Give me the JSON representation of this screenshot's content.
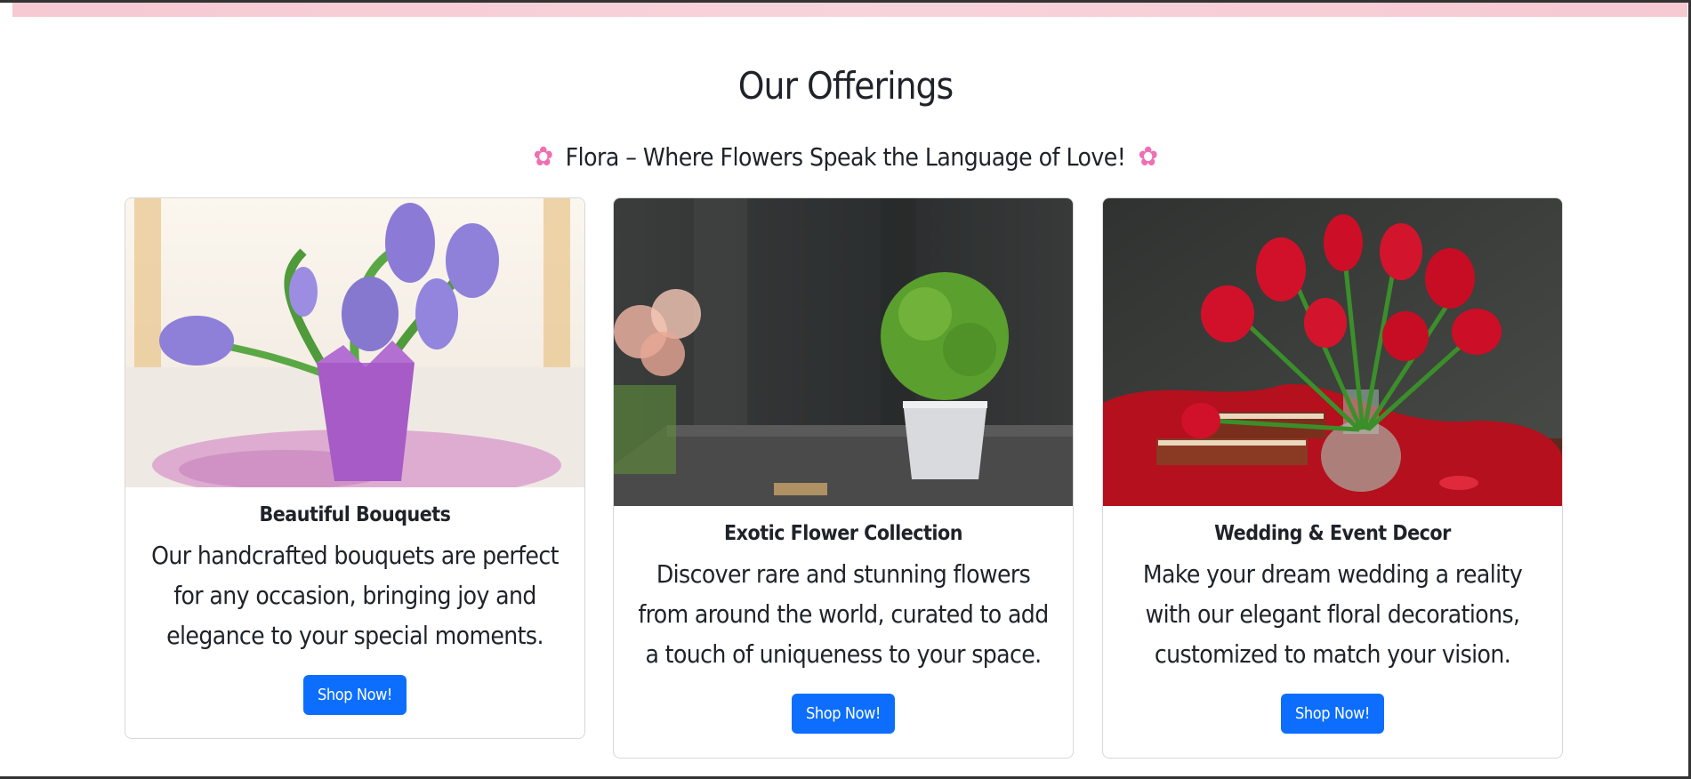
{
  "section": {
    "title": "Our Offerings",
    "tagline": "Flora – Where Flowers Speak the Language of Love!",
    "tagline_icon": "cherry-blossom-icon",
    "accent_color": "#f06fb3"
  },
  "cards": [
    {
      "image": "purple-hyacinth-bouquet",
      "title": "Beautiful Bouquets",
      "text": "Our handcrafted bouquets are perfect for any occasion, bringing joy and elegance to your special moments.",
      "button": "Shop Now!"
    },
    {
      "image": "potted-green-plant",
      "title": "Exotic Flower Collection",
      "text": "Discover rare and stunning flowers from around the world, curated to add a touch of uniqueness to your space.",
      "button": "Shop Now!"
    },
    {
      "image": "red-tulips-vase",
      "title": "Wedding & Event Decor",
      "text": "Make your dream wedding a reality with our elegant floral decorations, customized to match your vision.",
      "button": "Shop Now!"
    }
  ],
  "colors": {
    "button": "#0d6efd",
    "top_band": "#f6c9d3"
  }
}
